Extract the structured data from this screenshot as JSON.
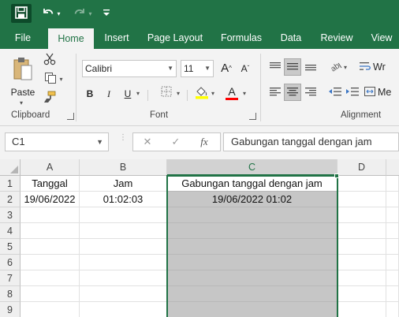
{
  "colors": {
    "accent": "#217346",
    "ribbon_bg": "#f3f3f3",
    "selection_fill": "#c6c6c6"
  },
  "quick_access": {
    "save_icon": "save-icon",
    "undo_icon": "undo-icon",
    "redo_icon": "redo-icon",
    "customize_icon": "customize-qat-icon"
  },
  "tabs": [
    {
      "label": "File",
      "active": false
    },
    {
      "label": "Home",
      "active": true
    },
    {
      "label": "Insert",
      "active": false
    },
    {
      "label": "Page Layout",
      "active": false
    },
    {
      "label": "Formulas",
      "active": false
    },
    {
      "label": "Data",
      "active": false
    },
    {
      "label": "Review",
      "active": false
    },
    {
      "label": "View",
      "active": false
    }
  ],
  "ribbon": {
    "clipboard": {
      "group_label": "Clipboard",
      "paste_label": "Paste"
    },
    "font": {
      "group_label": "Font",
      "font_name": "Calibri",
      "font_size": "11",
      "bold": "B",
      "italic": "I",
      "underline": "U",
      "grow": "A",
      "shrink": "A",
      "font_color_letter": "A"
    },
    "alignment": {
      "group_label": "Alignment",
      "wrap_text_partial": "Wr",
      "merge_partial": "Me"
    }
  },
  "formula_bar": {
    "name_box": "C1",
    "fx_label": "fx",
    "content": "Gabungan tanggal dengan jam"
  },
  "sheet": {
    "columns": [
      "A",
      "B",
      "C",
      "D"
    ],
    "selected_column": "C",
    "rows": [
      "1",
      "2",
      "3",
      "4",
      "5",
      "6",
      "7",
      "8",
      "9"
    ],
    "cells": {
      "A1": "Tanggal",
      "B1": "Jam",
      "C1": "Gabungan tanggal dengan jam",
      "A2": "19/06/2022",
      "B2": "01:02:03",
      "C2": "19/06/2022 01:02"
    }
  }
}
